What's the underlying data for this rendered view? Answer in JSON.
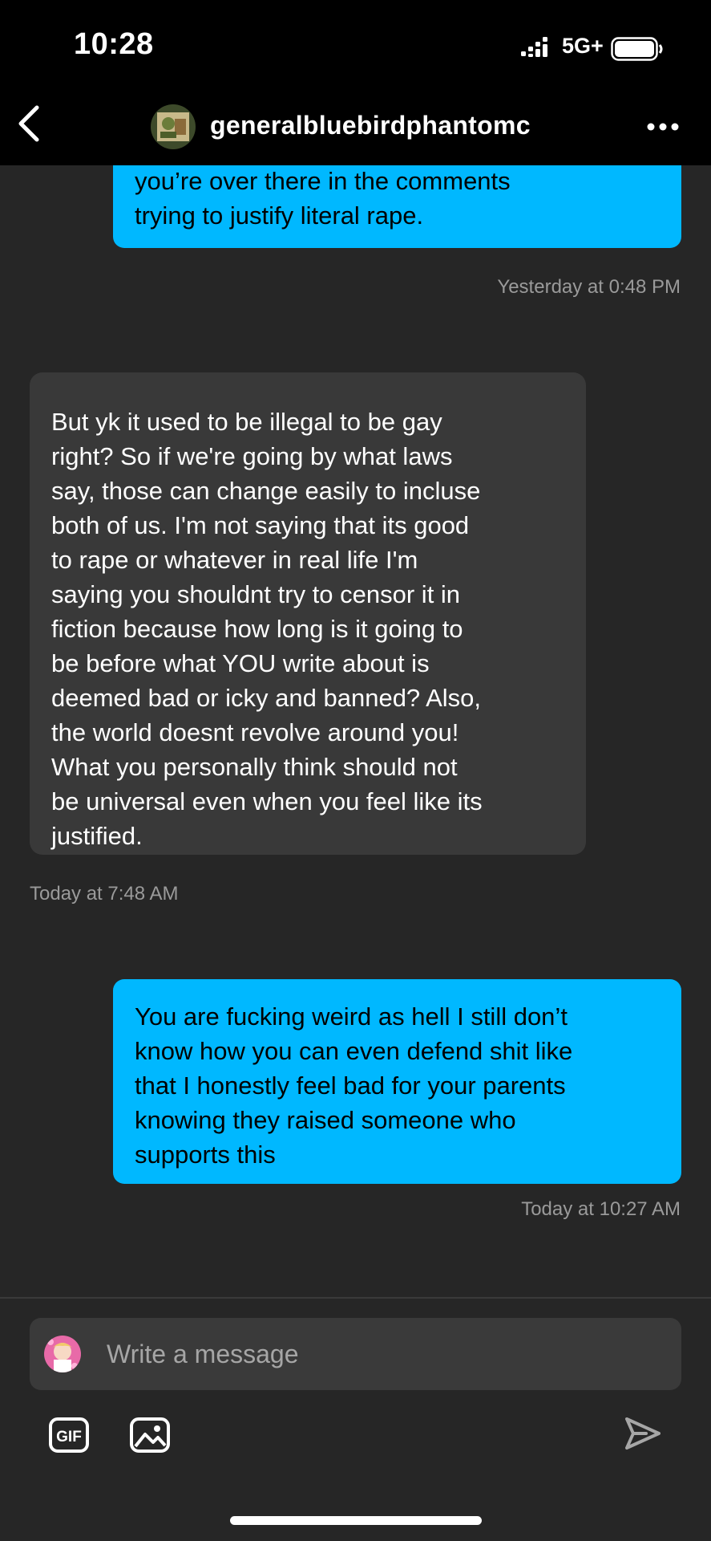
{
  "status_bar": {
    "time": "10:28",
    "network": "5G+"
  },
  "header": {
    "username": "generalbluebirdphantomc"
  },
  "messages": [
    {
      "direction": "outgoing",
      "text": "you’re over there in the comments\ntrying to justify literal rape.",
      "timestamp": "Yesterday at 0:48 PM"
    },
    {
      "direction": "incoming",
      "text": "But yk it used to be illegal to be gay\nright? So if we're going by what laws\nsay, those can change easily to incluse\nboth of us. I'm not saying that its good\nto rape or whatever in real life I'm\nsaying you shouldnt try to censor it in\nfiction because how long is it going to\nbe before what YOU write about is\ndeemed bad or icky and banned? Also,\nthe world doesnt revolve around you!\nWhat you personally think should not\nbe universal even when you feel like its\njustified.",
      "timestamp": "Today at 7:48 AM"
    },
    {
      "direction": "outgoing",
      "text": "You are fucking weird as hell I still don’t\nknow how you can even defend shit like\nthat I honestly feel bad for your parents\nknowing they raised someone who\nsupports this",
      "timestamp": "Today at 10:27 AM"
    }
  ],
  "composer": {
    "placeholder": "Write a message",
    "gif_label": "GIF"
  },
  "colors": {
    "background": "#262626",
    "outgoing_bubble": "#00b8ff",
    "incoming_bubble": "#393939",
    "header": "#000000"
  }
}
